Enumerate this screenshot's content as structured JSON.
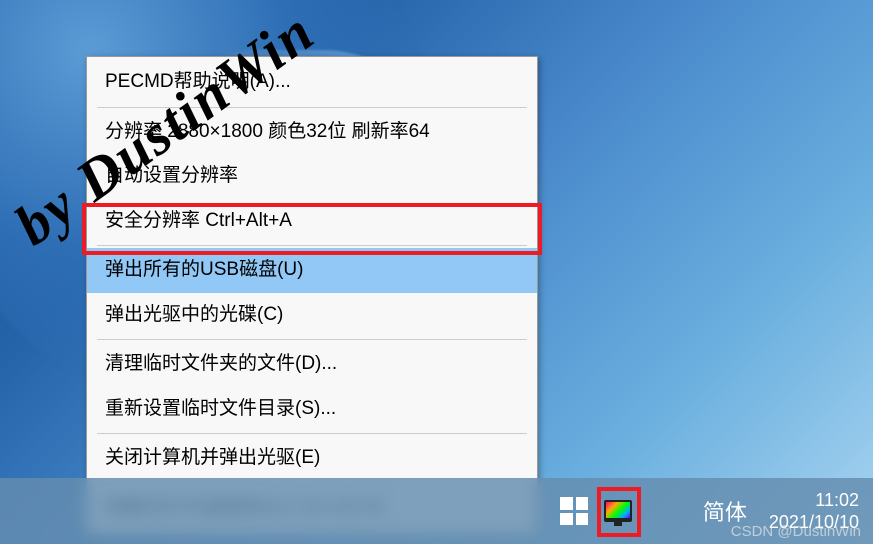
{
  "menu": {
    "items": [
      {
        "label": "PECMD帮助说明(A)...",
        "highlighted": false
      },
      {
        "sep": true
      },
      {
        "label": "分辨率 2880×1800 颜色32位 刷新率64",
        "highlighted": false
      },
      {
        "label": "自动设置分辨率",
        "highlighted": false
      },
      {
        "label": "安全分辨率 Ctrl+Alt+A",
        "highlighted": false
      },
      {
        "sep": true
      },
      {
        "label": "弹出所有的USB磁盘(U)",
        "highlighted": true
      },
      {
        "label": "弹出光驱中的光碟(C)",
        "highlighted": false
      },
      {
        "sep": true
      },
      {
        "label": "清理临时文件夹的文件(D)...",
        "highlighted": false
      },
      {
        "label": "重新设置临时文件目录(S)...",
        "highlighted": false
      },
      {
        "sep": true
      },
      {
        "label": "关闭计算机并弹出光驱(E)",
        "highlighted": false
      },
      {
        "sep": true
      },
      {
        "label": "隐藏/显示托盘图标(H) Ctrl+Alt+M",
        "highlighted": false
      }
    ]
  },
  "watermark": "by DustinWin",
  "taskbar": {
    "ime": "简体",
    "time": "11:02",
    "date": "2021/10/10"
  },
  "csdn": "CSDN @DustinWin"
}
